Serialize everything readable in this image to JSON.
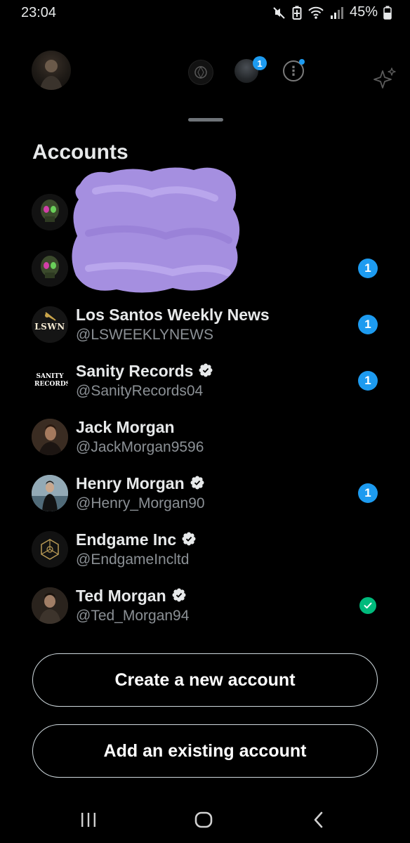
{
  "status_bar": {
    "time": "23:04",
    "battery_percent": "45%"
  },
  "background_header": {
    "notification_count": "1",
    "more_glyph": "⋮"
  },
  "sheet": {
    "title": "Accounts"
  },
  "accounts": [
    {
      "name": "",
      "handle": "",
      "avatar": "skull",
      "redacted": true,
      "verified": false,
      "badge": ""
    },
    {
      "name": "",
      "handle": "",
      "avatar": "skull",
      "redacted": true,
      "verified": false,
      "badge": "1"
    },
    {
      "name": "Los Santos Weekly News",
      "handle": "@LSWEEKLYNEWS",
      "avatar": "lswn-logo",
      "avatar_text": "LSWN",
      "verified": false,
      "badge": "1"
    },
    {
      "name": "Sanity Records",
      "handle": "@SanityRecords04",
      "avatar": "sanity-logo",
      "avatar_text": "SANITY RECORDS",
      "verified": true,
      "badge": "1"
    },
    {
      "name": "Jack Morgan",
      "handle": "@JackMorgan9596",
      "avatar": "photo",
      "verified": false,
      "badge": ""
    },
    {
      "name": "Henry Morgan",
      "handle": "@Henry_Morgan90",
      "avatar": "photo",
      "verified": true,
      "badge": "1"
    },
    {
      "name": "Endgame Inc",
      "handle": "@EndgameIncltd",
      "avatar": "endgame-logo",
      "verified": true,
      "badge": ""
    },
    {
      "name": "Ted Morgan",
      "handle": "@Ted_Morgan94",
      "avatar": "photo",
      "verified": true,
      "active": true
    }
  ],
  "buttons": {
    "create_label": "Create a new account",
    "add_label": "Add an existing account"
  },
  "colors": {
    "accent": "#1d9bf0",
    "active_check": "#00ba7c",
    "redaction": "#a58fe0",
    "background": "#000000"
  }
}
